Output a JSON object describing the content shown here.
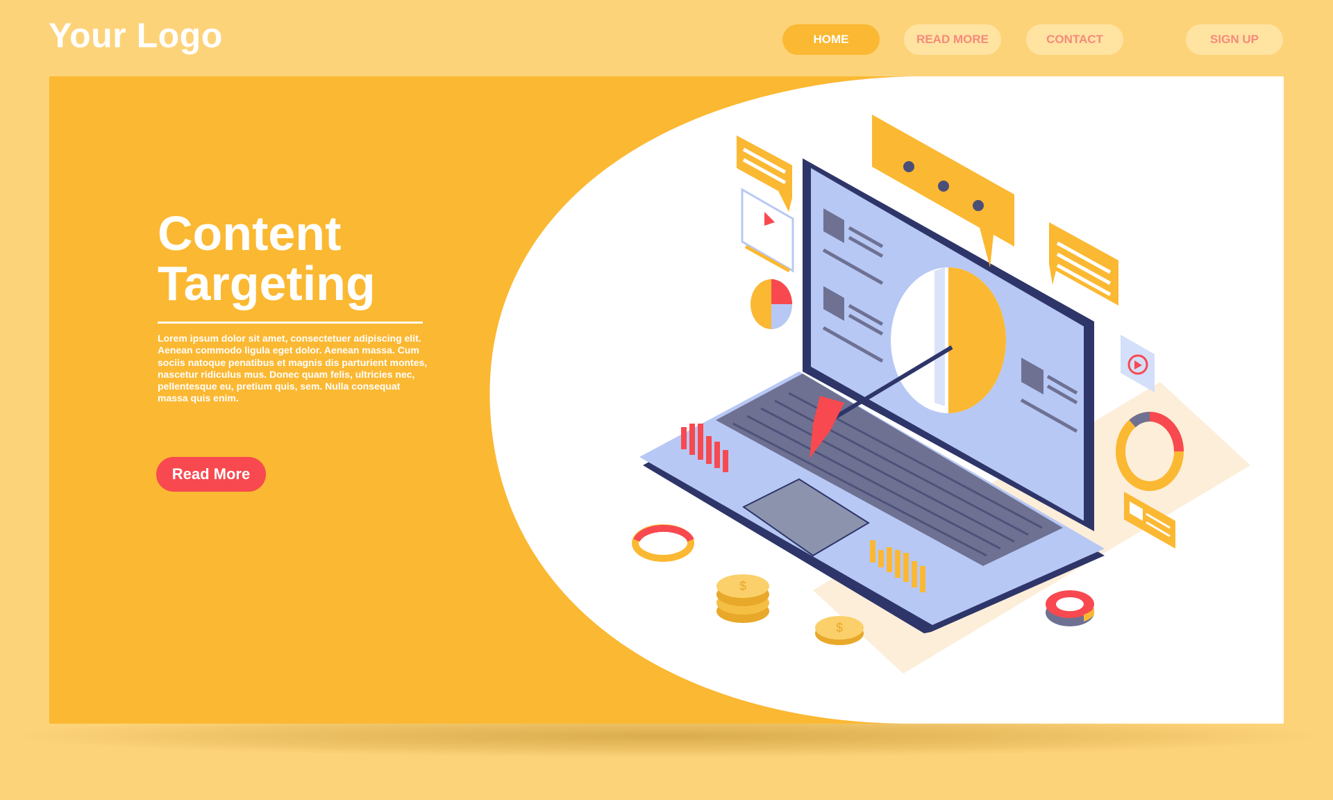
{
  "header": {
    "logo_text": "Your Logo",
    "nav": {
      "home": "HOME",
      "read_more": "READ MORE",
      "contact": "CONTACT",
      "sign_up": "SIGN UP"
    }
  },
  "hero": {
    "title_line_1": "Content",
    "title_line_2": "Targeting",
    "body": "Lorem ipsum dolor sit amet, consectetuer adipiscing elit. Aenean commodo ligula eget dolor. Aenean massa. Cum sociis natoque penatibus et magnis dis parturient montes, nascetur ridiculus mus. Donec quam felis, ultricies nec, pellentesque eu, pretium quis, sem. Nulla consequat massa quis enim.",
    "cta_label": "Read More"
  },
  "illustration": {
    "subject": "laptop-targeting-illustration",
    "colors": {
      "accent": "#fbb832",
      "coral": "#f7494f",
      "navy": "#2e3569",
      "laptop_blue": "#b7c8f5",
      "background": "#fdd37a"
    }
  }
}
